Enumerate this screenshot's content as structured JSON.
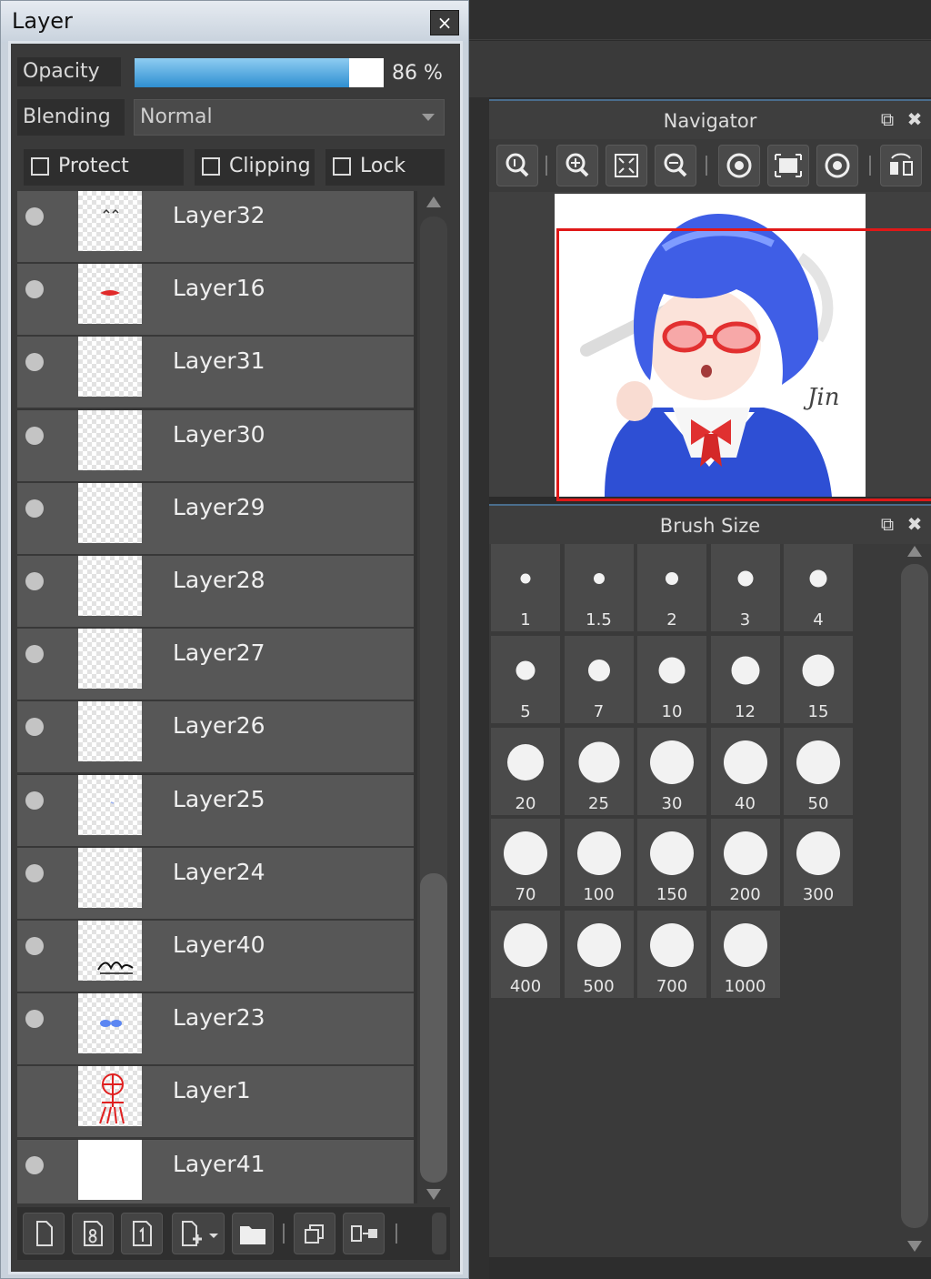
{
  "layer_panel": {
    "title": "Layer",
    "close": "×",
    "opacity_label": "Opacity",
    "opacity_value": "86 %",
    "opacity_fraction": 0.86,
    "blending_label": "Blending",
    "blending_value": "Normal",
    "protect_alpha": "Protect Alpha",
    "clipping": "Clipping",
    "lock": "Lock",
    "layers": [
      {
        "name": "Layer32",
        "visible": true
      },
      {
        "name": "Layer16",
        "visible": true
      },
      {
        "name": "Layer31",
        "visible": true
      },
      {
        "name": "Layer30",
        "visible": true
      },
      {
        "name": "Layer29",
        "visible": true
      },
      {
        "name": "Layer28",
        "visible": true
      },
      {
        "name": "Layer27",
        "visible": true
      },
      {
        "name": "Layer26",
        "visible": true
      },
      {
        "name": "Layer25",
        "visible": true
      },
      {
        "name": "Layer24",
        "visible": true
      },
      {
        "name": "Layer40",
        "visible": true
      },
      {
        "name": "Layer23",
        "visible": true
      },
      {
        "name": "Layer1",
        "visible": false
      },
      {
        "name": "Layer41",
        "visible": true
      }
    ],
    "toolbar_icons": [
      "new-layer-icon",
      "new-8bit-layer-icon",
      "new-1bit-layer-icon",
      "add-layer-dropdown-icon",
      "new-folder-icon",
      "duplicate-layer-icon",
      "merge-down-icon"
    ]
  },
  "navigator": {
    "title": "Navigator",
    "icons": [
      "zoom-actual-icon",
      "zoom-in-icon",
      "fit-window-icon",
      "zoom-out-icon",
      "rotate-left-icon",
      "reset-view-icon",
      "rotate-right-icon",
      "flip-horizontal-icon"
    ],
    "signature": "Jin"
  },
  "brush_size": {
    "title": "Brush Size",
    "sizes": [
      "1",
      "1.5",
      "2",
      "3",
      "4",
      "5",
      "7",
      "10",
      "12",
      "15",
      "20",
      "25",
      "30",
      "40",
      "50",
      "70",
      "100",
      "150",
      "200",
      "300",
      "400",
      "500",
      "700",
      "1000"
    ]
  }
}
